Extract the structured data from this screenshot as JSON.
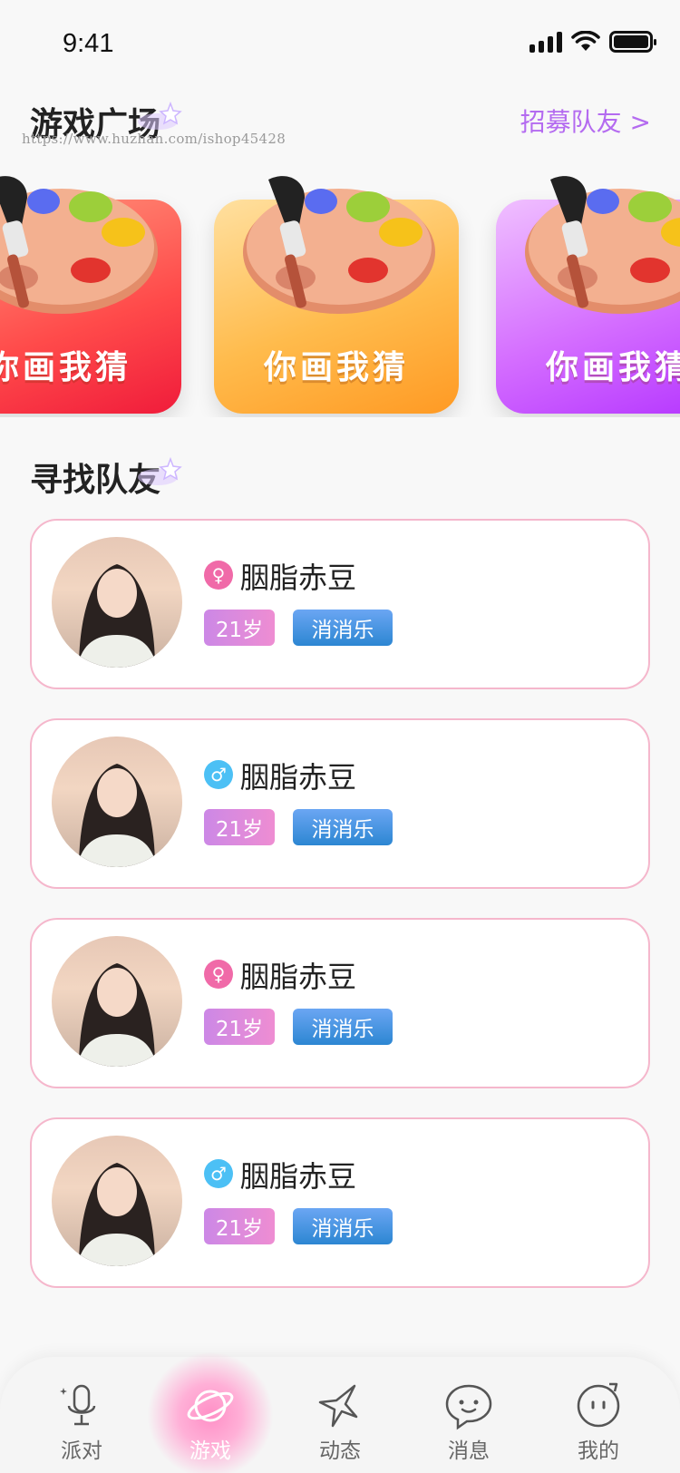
{
  "status_bar": {
    "time": "9:41"
  },
  "games_section": {
    "title": "游戏广场",
    "recruit_link": "招募队友 >",
    "watermark": "https://www.huzhan.com/ishop45428",
    "cards": [
      {
        "title": "你画我猜"
      },
      {
        "title": "你画我猜"
      },
      {
        "title": "你画我猜"
      }
    ]
  },
  "teammates_section": {
    "title": "寻找队友",
    "items": [
      {
        "name": "胭脂赤豆",
        "gender": "female",
        "age": "21岁",
        "game": "消消乐"
      },
      {
        "name": "胭脂赤豆",
        "gender": "male",
        "age": "21岁",
        "game": "消消乐"
      },
      {
        "name": "胭脂赤豆",
        "gender": "female",
        "age": "21岁",
        "game": "消消乐"
      },
      {
        "name": "胭脂赤豆",
        "gender": "male",
        "age": "21岁",
        "game": "消消乐"
      }
    ]
  },
  "tab_bar": {
    "active": "游戏",
    "tabs": [
      {
        "label": "派对",
        "icon": "microphone-icon"
      },
      {
        "label": "游戏",
        "icon": "planet-icon"
      },
      {
        "label": "动态",
        "icon": "star-icon"
      },
      {
        "label": "消息",
        "icon": "chat-bubble-icon"
      },
      {
        "label": "我的",
        "icon": "face-icon"
      }
    ]
  },
  "colors": {
    "accent_link": "#b46bf0",
    "card_border": "#f5b7cc",
    "female": "#f06aa8",
    "male": "#4cc0f5",
    "active_tab_glow": "#ff8fc6"
  }
}
